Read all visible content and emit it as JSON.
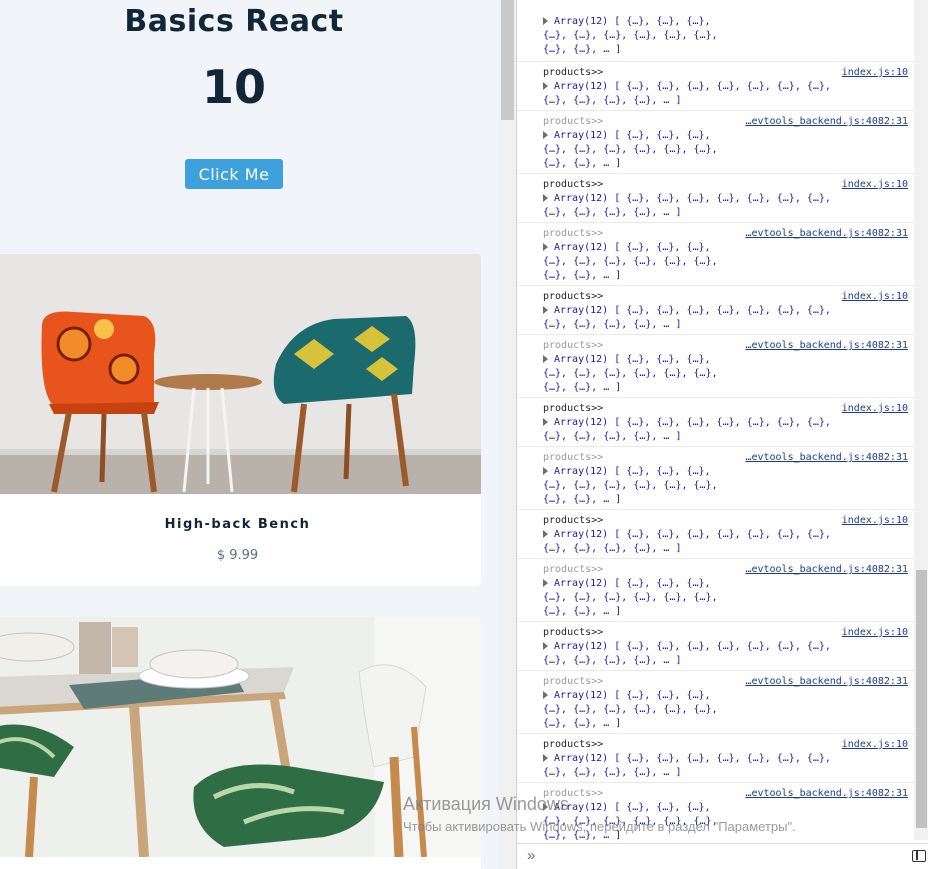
{
  "app": {
    "title": "Basics React",
    "counter": "10",
    "button_label": "Click Me",
    "products": [
      {
        "name": "High-back Bench",
        "price": "$ 9.99"
      },
      {
        "name": "",
        "price": ""
      }
    ]
  },
  "console": {
    "logs": [
      {
        "label": "products>>",
        "source": "index.js:10",
        "array_text": "Array(12) [ {…}, {…}, {…}, {…}, {…}, {…}, {…}, {…}, {…}, {…}, {…}, … ]"
      },
      {
        "label": "products>>",
        "source": "…evtools_backend.js:4082:31",
        "array_text": "Array(12) [ {…}, {…}, {…}, {…}, {…}, {…}, {…}, {…}, {…}, {…}, {…}, … ]"
      }
    ],
    "array_lines": {
      "wide": [
        "Array(12) [ {…}, {…}, {…}, {…}, {…}, {…}, {…},",
        "{…}, {…}, {…}, {…}, … ]"
      ],
      "narrow": [
        "Array(12) [ {…}, {…}, {…},",
        "{…}, {…}, {…}, {…}, {…}, {…},",
        "{…}, {…}, … ]"
      ]
    },
    "top_partial_line": "{…}, {…}, {…}, {…}, {…}, {…},",
    "prompt_icon": "»"
  },
  "watermark": {
    "title": "Активация Windows",
    "subtitle": "Чтобы активировать Windows, перейдите в раздел \"Параметры\"."
  }
}
